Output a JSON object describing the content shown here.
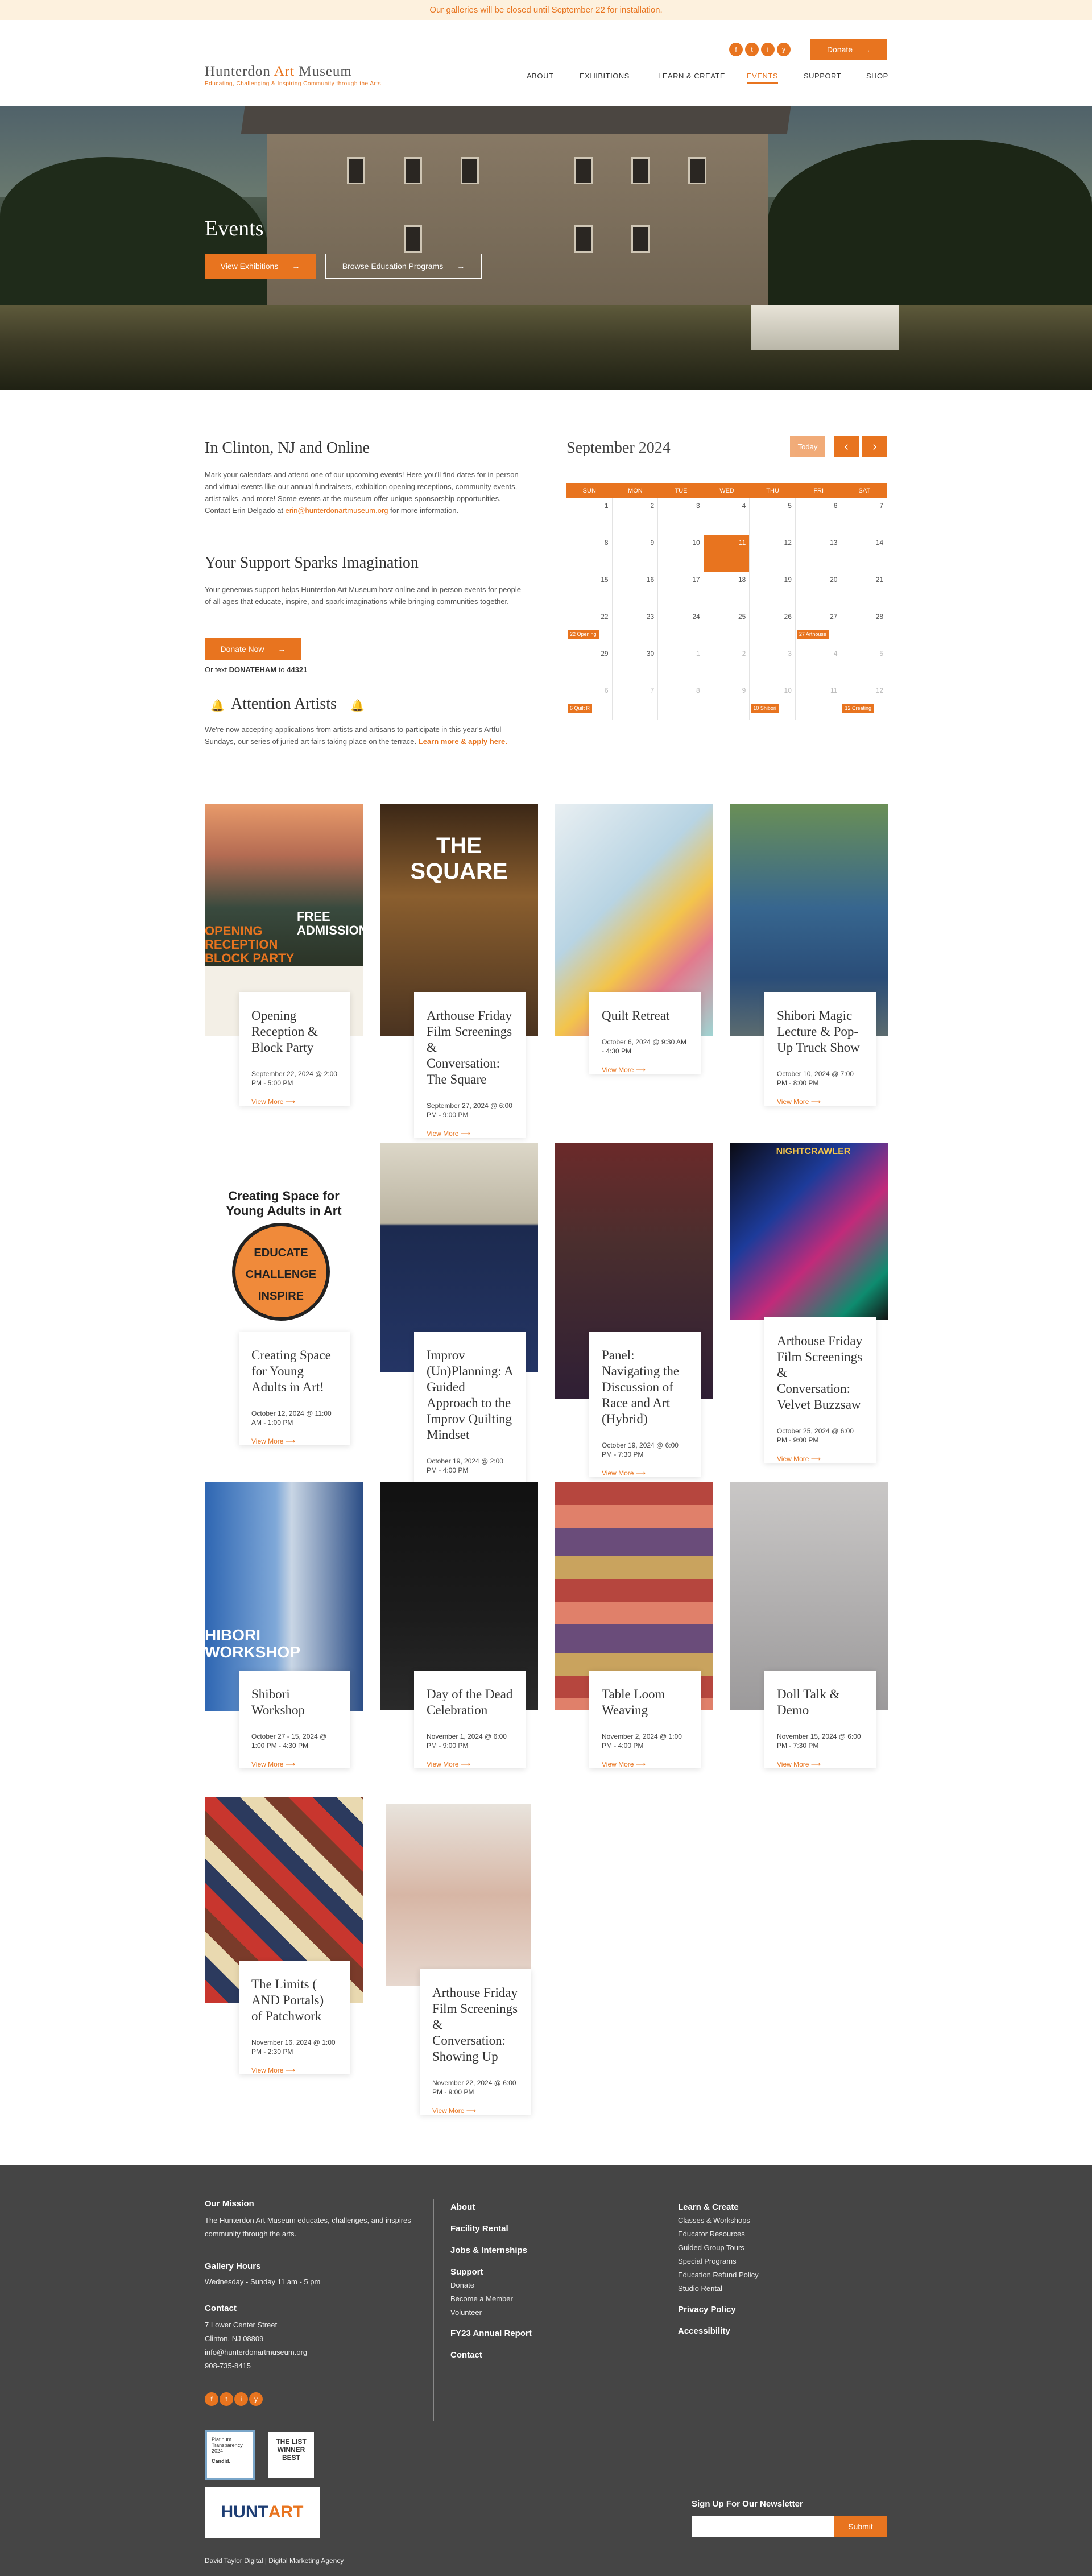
{
  "banner": {
    "text": "Our galleries will be closed until September 22 for installation."
  },
  "header": {
    "logo_title_pre": "Hunterdon ",
    "logo_title_art": "Art",
    "logo_title_post": " Museum",
    "logo_tagline": "Educating, Challenging & Inspiring Community through the Arts",
    "donate_label": "Donate",
    "social": [
      "f",
      "t",
      "i",
      "y"
    ],
    "nav": [
      "ABOUT",
      "EXHIBITIONS",
      "LEARN & CREATE",
      "EVENTS",
      "SUPPORT",
      "SHOP"
    ]
  },
  "hero": {
    "title": "Events",
    "btn_exhibitions": "View Exhibitions",
    "btn_education": "Browse Education Programs"
  },
  "intro": {
    "heading": "In Clinton, NJ and Online",
    "body": "Mark your calendars and attend one of our upcoming events! Here you'll find dates for in-person and virtual events like our annual fundraisers, exhibition opening receptions, community events, artist talks, and more! Some events at the museum offer unique sponsorship opportunities. Contact Erin Delgado at",
    "email": "erin@hunterdonartmuseum.org",
    "body_end": " for more information.",
    "support_heading": "Your Support Sparks Imagination",
    "support_body": "Your generous support helps Hunterdon Art Museum host online and in-person events for people of all ages that educate, inspire, and spark imaginations while bringing communities together.",
    "donate_now": "Donate Now",
    "text_line_pre": "Or text ",
    "text_keyword": "DONATEHAM",
    "text_line_mid": " to ",
    "text_number": "44321",
    "attention_heading": "Attention Artists",
    "attention_body": "We're now accepting applications from artists and artisans to participate in this year's Artful Sundays, our series of juried art fairs taking place on the terrace.",
    "attention_link": "Learn more & apply here."
  },
  "calendar": {
    "month": "September 2024",
    "today_label": "Today",
    "prev": "‹",
    "next": "›",
    "weekdays": [
      "SUN",
      "MON",
      "TUE",
      "WED",
      "THU",
      "FRI",
      "SAT"
    ],
    "weeks": [
      [
        "1",
        "2",
        "3",
        "4",
        "5",
        "6",
        "7"
      ],
      [
        "8",
        "9",
        "10",
        "11",
        "12",
        "13",
        "14"
      ],
      [
        "15",
        "16",
        "17",
        "18",
        "19",
        "20",
        "21"
      ],
      [
        "22",
        "23",
        "24",
        "25",
        "26",
        "27",
        "28"
      ],
      [
        "29",
        "30",
        "1",
        "2",
        "3",
        "4",
        "5"
      ],
      [
        "6",
        "7",
        "8",
        "9",
        "10",
        "11",
        "12"
      ]
    ],
    "events": {
      "e1": "22 Opening",
      "e2": "27 Arthouse",
      "e3": "6 Quilt R",
      "e4": "10 Shibori",
      "e5": "12 Creating"
    }
  },
  "events": [
    {
      "title": "Opening Reception & Block Party",
      "date": "September 22, 2024 @ 2:00 PM - 5:00 PM",
      "more": "View More"
    },
    {
      "title": "Arthouse Friday Film Screenings & Conversation: The Square",
      "date": "September 27, 2024 @ 6:00 PM - 9:00 PM",
      "more": "View More"
    },
    {
      "title": "Quilt Retreat",
      "date": "October 6, 2024 @ 9:30 AM - 4:30 PM",
      "more": "View More"
    },
    {
      "title": "Shibori Magic Lecture & Pop-Up Truck Show",
      "date": "October 10, 2024 @ 7:00 PM - 8:00 PM",
      "more": "View More"
    },
    {
      "title": "Creating Space for Young Adults in Art!",
      "date": "October 12, 2024 @ 11:00 AM - 1:00 PM",
      "more": "View More"
    },
    {
      "title": "Improv (Un)Planning: A Guided Approach to the Improv Quilting Mindset",
      "date": "October 19, 2024 @ 2:00 PM - 4:00 PM",
      "more": "View More"
    },
    {
      "title": "Panel: Navigating the Discussion of Race and Art (Hybrid)",
      "date": "October 19, 2024 @ 6:00 PM - 7:30 PM",
      "more": "View More"
    },
    {
      "title": "Arthouse Friday Film Screenings & Conversation: Velvet Buzzsaw",
      "date": "October 25, 2024 @ 6:00 PM - 9:00 PM",
      "more": "View More"
    },
    {
      "title": "Shibori Workshop",
      "date": "October 27 - 15, 2024 @ 1:00 PM - 4:30 PM",
      "more": "View More"
    },
    {
      "title": "Day of the Dead Celebration",
      "date": "November 1, 2024 @ 6:00 PM - 9:00 PM",
      "more": "View More"
    },
    {
      "title": "Table Loom Weaving",
      "date": "November 2, 2024 @ 1:00 PM - 4:00 PM",
      "more": "View More"
    },
    {
      "title": "Doll Talk & Demo",
      "date": "November 15, 2024 @ 6:00 PM - 7:30 PM",
      "more": "View More"
    },
    {
      "title": "The Limits ( AND Portals) of Patchwork",
      "date": "November 16, 2024 @ 1:00 PM - 2:30 PM",
      "more": "View More"
    },
    {
      "title": "Arthouse Friday Film Screenings & Conversation: Showing Up",
      "date": "November 22, 2024 @ 6:00 PM - 9:00 PM",
      "more": "View More"
    }
  ],
  "poster_text": {
    "opening_free": "FREE ADMISSION",
    "opening_big": "OPENING RECEPTION BLOCK PARTY",
    "square": "THE SQUARE",
    "creating_ring": "Creating Space for Young Adults in Art",
    "creating_center": "EDUCATE CHALLENGE INSPIRE",
    "nightcrawler": "NIGHTCRAWLER",
    "shibori": "HIBORI WORKSHOP"
  },
  "footer": {
    "mission_heading": "Our Mission",
    "mission_body": "The Hunterdon Art Museum educates, challenges, and inspires community through the arts.",
    "hours_heading": "Gallery Hours",
    "hours_body": "Wednesday - Sunday 11 am - 5 pm",
    "contact_heading": "Contact",
    "address1": "7 Lower Center Street",
    "address2": "Clinton, NJ 08809",
    "email": "info@hunterdonartmuseum.org",
    "phone": "908-735-8415",
    "col2": [
      "About",
      "Facility Rental",
      "Jobs & Internships"
    ],
    "support_heading": "Support",
    "support_items": [
      "Donate",
      "Become a Member",
      "Volunteer"
    ],
    "col2b": [
      "FY23 Annual Report",
      "Contact"
    ],
    "learn_heading": "Learn & Create",
    "learn_items": [
      "Classes & Workshops",
      "Educator Resources",
      "Guided Group Tours",
      "Special Programs",
      "Education Refund Policy",
      "Studio Rental"
    ],
    "privacy": "Privacy Policy",
    "accessibility": "Accessibility",
    "newsletter_heading": "Sign Up For Our Newsletter",
    "submit": "Submit",
    "badge_candid_1": "Platinum Transparency 2024",
    "badge_candid_2": "Candid.",
    "badge_list": "THE LIST WINNER BEST",
    "hunt_art_1": "HUNT",
    "hunt_art_2": "ART",
    "credit": "David Taylor Digital | Digital Marketing Agency"
  }
}
